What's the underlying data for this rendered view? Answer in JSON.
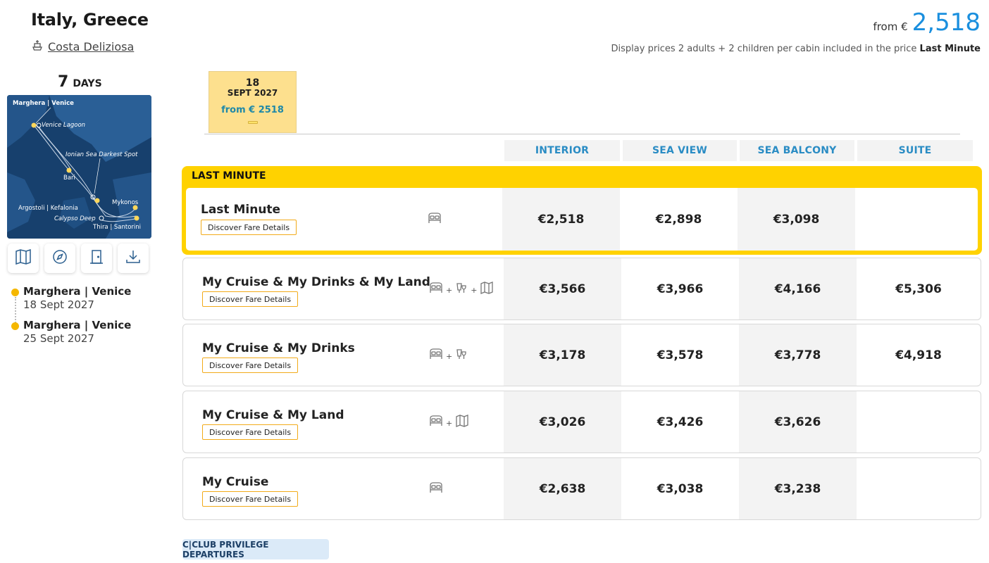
{
  "header": {
    "destination": "Italy, Greece",
    "ship": "Costa Deliziosa",
    "from_label": "from €",
    "from_price": "2,518",
    "display_note": "Display prices 2 adults + 2 children per cabin included in the price",
    "display_note_bold": "Last Minute"
  },
  "trip": {
    "days_num": "7",
    "days_label": "DAYS"
  },
  "map": {
    "labels": {
      "embark": "Marghera | Venice",
      "lagoon": "Venice Lagoon",
      "ionian": "Ionian Sea Darkest Spot",
      "bari": "Bari",
      "argostoli": "Argostoli | Kefalonia",
      "calypso": "Calypso Deep",
      "mykonos": "Mykonos",
      "thira": "Thira | Santorini"
    }
  },
  "tools": [
    {
      "icon": "map-icon"
    },
    {
      "icon": "compass-icon"
    },
    {
      "icon": "door-icon"
    },
    {
      "icon": "download-icon"
    }
  ],
  "itinerary": [
    {
      "port": "Marghera | Venice",
      "date": "18 Sept 2027"
    },
    {
      "port": "Marghera | Venice",
      "date": "25 Sept 2027"
    }
  ],
  "date_tab": {
    "day": "18",
    "month": "SEPT 2027",
    "from_price": "from € 2518"
  },
  "cabins": [
    "INTERIOR",
    "SEA VIEW",
    "SEA BALCONY",
    "SUITE"
  ],
  "last_minute_label": "LAST MINUTE",
  "fare_details_label": "Discover Fare Details",
  "fares": [
    {
      "name": "Last Minute",
      "icons": [
        "cruise-icon"
      ],
      "prices": [
        "€2,518",
        "€2,898",
        "€3,098",
        ""
      ]
    },
    {
      "name": "My Cruise & My Drinks & My Land",
      "icons": [
        "cruise-icon",
        "drinks-icon",
        "land-icon"
      ],
      "prices": [
        "€3,566",
        "€3,966",
        "€4,166",
        "€5,306"
      ]
    },
    {
      "name": "My Cruise & My Drinks",
      "icons": [
        "cruise-icon",
        "drinks-icon"
      ],
      "prices": [
        "€3,178",
        "€3,578",
        "€3,778",
        "€4,918"
      ]
    },
    {
      "name": "My Cruise & My Land",
      "icons": [
        "cruise-icon",
        "land-icon"
      ],
      "prices": [
        "€3,026",
        "€3,426",
        "€3,626",
        ""
      ]
    },
    {
      "name": "My Cruise",
      "icons": [
        "cruise-icon"
      ],
      "prices": [
        "€2,638",
        "€3,038",
        "€3,238",
        ""
      ]
    }
  ],
  "club_button": "C|CLUB PRIVILEGE DEPARTURES"
}
